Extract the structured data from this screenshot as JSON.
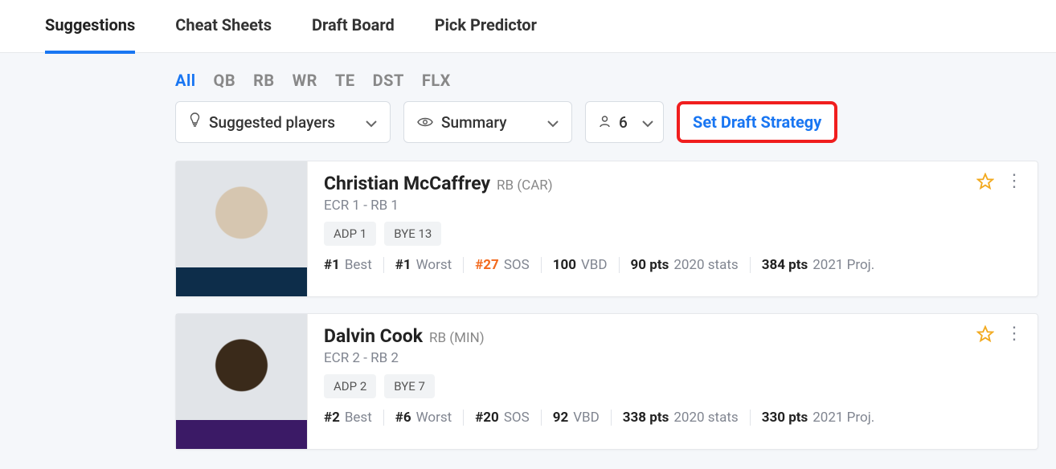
{
  "nav": {
    "tabs": [
      {
        "label": "Suggestions",
        "active": true
      },
      {
        "label": "Cheat Sheets",
        "active": false
      },
      {
        "label": "Draft Board",
        "active": false
      },
      {
        "label": "Pick Predictor",
        "active": false
      }
    ]
  },
  "positionFilters": [
    {
      "label": "All",
      "active": true
    },
    {
      "label": "QB",
      "active": false
    },
    {
      "label": "RB",
      "active": false
    },
    {
      "label": "WR",
      "active": false
    },
    {
      "label": "TE",
      "active": false
    },
    {
      "label": "DST",
      "active": false
    },
    {
      "label": "FLX",
      "active": false
    }
  ],
  "controls": {
    "suggested": {
      "label": "Suggested players"
    },
    "view": {
      "label": "Summary"
    },
    "count": {
      "label": "6"
    },
    "strategyButton": "Set Draft Strategy"
  },
  "players": [
    {
      "name": "Christian McCaffrey",
      "posTeam": "RB (CAR)",
      "ecr": "ECR 1 - RB 1",
      "badges": [
        {
          "text": "ADP 1"
        },
        {
          "text": "BYE 13"
        }
      ],
      "stats": {
        "best": {
          "val": "#1",
          "lbl": "Best"
        },
        "worst": {
          "val": "#1",
          "lbl": "Worst"
        },
        "sos": {
          "val": "#27",
          "lbl": "SOS",
          "hot": true
        },
        "vbd": {
          "val": "100",
          "lbl": "VBD"
        },
        "pts2020": {
          "val": "90 pts",
          "lbl": "2020 stats"
        },
        "pts2021": {
          "val": "384 pts",
          "lbl": "2021 Proj."
        }
      }
    },
    {
      "name": "Dalvin Cook",
      "posTeam": "RB (MIN)",
      "ecr": "ECR 2 - RB 2",
      "badges": [
        {
          "text": "ADP 2"
        },
        {
          "text": "BYE 7"
        }
      ],
      "stats": {
        "best": {
          "val": "#2",
          "lbl": "Best"
        },
        "worst": {
          "val": "#6",
          "lbl": "Worst"
        },
        "sos": {
          "val": "#20",
          "lbl": "SOS",
          "hot": false
        },
        "vbd": {
          "val": "92",
          "lbl": "VBD"
        },
        "pts2020": {
          "val": "338 pts",
          "lbl": "2020 stats"
        },
        "pts2021": {
          "val": "330 pts",
          "lbl": "2021 Proj."
        }
      }
    }
  ]
}
